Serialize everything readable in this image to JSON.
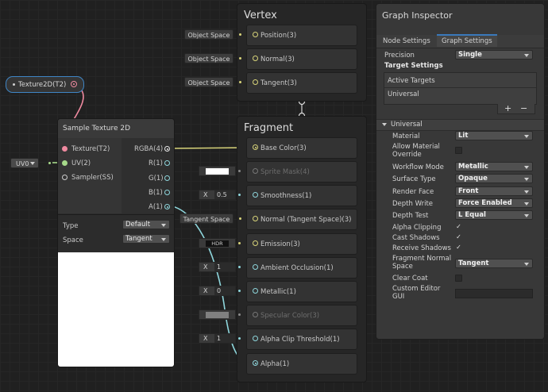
{
  "texture_node": {
    "label": "Texture2D(T2)"
  },
  "uv_node": {
    "value": "UV0"
  },
  "sample_node": {
    "title": "Sample Texture 2D",
    "inputs": [
      "Texture(T2)",
      "UV(2)",
      "Sampler(SS)"
    ],
    "outputs": [
      "RGBA(4)",
      "R(1)",
      "G(1)",
      "B(1)",
      "A(1)"
    ],
    "type_label": "Type",
    "type_value": "Default",
    "space_label": "Space",
    "space_value": "Tangent"
  },
  "vertex": {
    "title": "Vertex",
    "ports": [
      {
        "label": "Position(3)",
        "input": "Object Space"
      },
      {
        "label": "Normal(3)",
        "input": "Object Space"
      },
      {
        "label": "Tangent(3)",
        "input": "Object Space"
      }
    ]
  },
  "fragment": {
    "title": "Fragment",
    "ports": [
      {
        "label": "Base Color(3)"
      },
      {
        "label": "Sprite Mask(4)"
      },
      {
        "label": "Smoothness(1)",
        "x_label": "X",
        "value": "0.5"
      },
      {
        "label": "Normal (Tangent Space)(3)",
        "input": "Tangent Space"
      },
      {
        "label": "Emission(3)",
        "input": "HDR"
      },
      {
        "label": "Ambient Occlusion(1)",
        "x_label": "X",
        "value": "1"
      },
      {
        "label": "Metallic(1)",
        "x_label": "X",
        "value": "0"
      },
      {
        "label": "Specular Color(3)"
      },
      {
        "label": "Alpha Clip Threshold(1)",
        "x_label": "X",
        "value": "1"
      },
      {
        "label": "Alpha(1)"
      }
    ]
  },
  "inspector": {
    "title": "Graph Inspector",
    "tabs": [
      "Node Settings",
      "Graph Settings"
    ],
    "precision_label": "Precision",
    "precision_value": "Single",
    "target_settings": "Target Settings",
    "active_targets": "Active Targets",
    "targets": [
      "Universal"
    ],
    "add": "+",
    "remove": "−",
    "section": "Universal",
    "rows": [
      {
        "label": "Material",
        "kind": "dropdown",
        "value": "Lit"
      },
      {
        "label": "Allow Material Override",
        "kind": "checkbox",
        "checked": false
      },
      {
        "label": "Workflow Mode",
        "kind": "dropdown",
        "value": "Metallic"
      },
      {
        "label": "Surface Type",
        "kind": "dropdown",
        "value": "Opaque"
      },
      {
        "label": "Render Face",
        "kind": "dropdown",
        "value": "Front"
      },
      {
        "label": "Depth Write",
        "kind": "dropdown",
        "value": "Force Enabled"
      },
      {
        "label": "Depth Test",
        "kind": "dropdown",
        "value": "L Equal"
      },
      {
        "label": "Alpha Clipping",
        "kind": "checkbox",
        "checked": true
      },
      {
        "label": "Cast Shadows",
        "kind": "checkbox",
        "checked": true
      },
      {
        "label": "Receive Shadows",
        "kind": "checkbox",
        "checked": true
      },
      {
        "label": "Fragment Normal Space",
        "kind": "dropdown",
        "value": "Tangent"
      },
      {
        "label": "Clear Coat",
        "kind": "checkbox",
        "checked": false
      },
      {
        "label": "Custom Editor GUI",
        "kind": "text",
        "value": ""
      }
    ],
    "check_glyph": "✓"
  }
}
